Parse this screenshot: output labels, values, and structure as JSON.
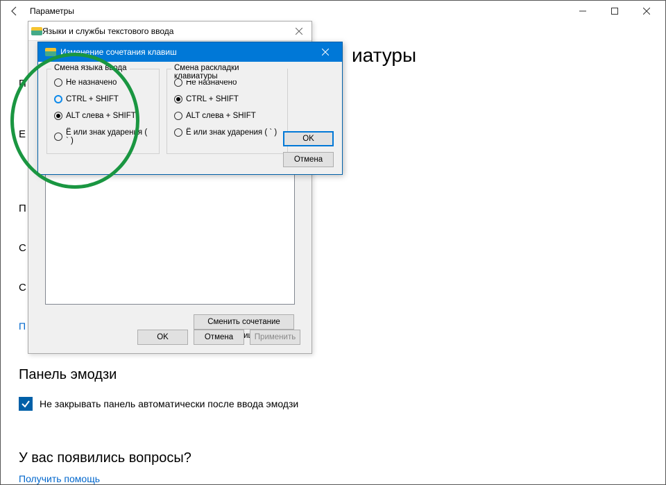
{
  "settings": {
    "title": "Параметры",
    "heading_fragment": "иатуры",
    "stubs": [
      "П",
      "Е",
      "П",
      "С",
      "С"
    ],
    "link_stub": "П",
    "emoji": {
      "heading": "Панель эмодзи",
      "checkbox_label": "Не закрывать панель автоматически после ввода эмодзи",
      "checked": true
    },
    "questions": {
      "heading": "У вас появились вопросы?",
      "help_link": "Получить помощь"
    }
  },
  "text_services": {
    "title": "Языки и службы текстового ввода",
    "change_btn": "Сменить сочетание клавиш...",
    "ok": "OK",
    "cancel": "Отмена",
    "apply": "Применить"
  },
  "change_dialog": {
    "title": "Изменение сочетания клавиш",
    "group1": {
      "legend": "Смена языка ввода",
      "options": [
        "Не назначено",
        "CTRL + SHIFT",
        "ALT слева + SHIFT",
        "Ё или знак ударения ( ` )"
      ],
      "selected": 2
    },
    "group2": {
      "legend": "Смена раскладки клавиатуры",
      "options": [
        "Не назначено",
        "CTRL + SHIFT",
        "ALT слева + SHIFT",
        "Ё или знак ударения ( ` )"
      ],
      "selected": 1
    },
    "ok": "OK",
    "cancel": "Отмена"
  }
}
